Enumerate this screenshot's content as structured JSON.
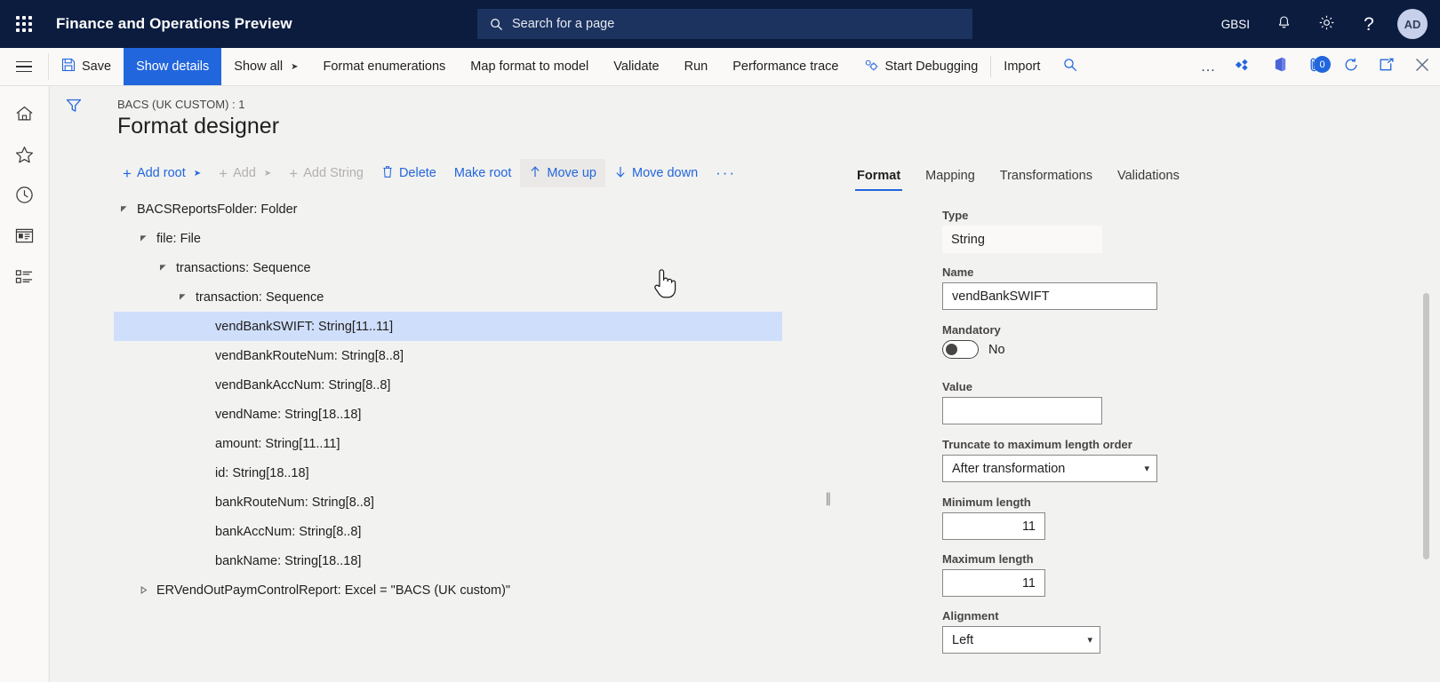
{
  "topnav": {
    "waffle_label": "app-launcher",
    "app_title": "Finance and Operations Preview",
    "search_placeholder": "Search for a page",
    "company": "GBSI",
    "notifications_icon": "bell-icon",
    "settings_icon": "gear-icon",
    "help_icon": "question-mark-icon",
    "avatar_initials": "AD"
  },
  "commandbar": {
    "menu_icon": "hamburger-icon",
    "save_label": "Save",
    "show_details_label": "Show details",
    "show_all_label": "Show all",
    "format_enumerations_label": "Format enumerations",
    "map_format_to_model_label": "Map format to model",
    "validate_label": "Validate",
    "run_label": "Run",
    "performance_trace_label": "Performance trace",
    "start_debugging_label": "Start Debugging",
    "import_label": "Import",
    "search_icon": "search-icon",
    "overflow_label": "…",
    "attachments_badge": "0"
  },
  "rail": {
    "items": [
      {
        "icon": "home-icon",
        "name": "home"
      },
      {
        "icon": "star-icon",
        "name": "favorites"
      },
      {
        "icon": "clock-icon",
        "name": "recent"
      },
      {
        "icon": "workspace-icon",
        "name": "workspaces"
      },
      {
        "icon": "modules-icon",
        "name": "modules"
      }
    ],
    "filter_icon": "filter-icon"
  },
  "page": {
    "breadcrumb": "BACS (UK CUSTOM) : 1",
    "title": "Format designer"
  },
  "designer_toolbar": {
    "add_root": "Add root",
    "add": "Add",
    "add_string": "Add String",
    "delete": "Delete",
    "make_root": "Make root",
    "move_up": "Move up",
    "move_down": "Move down",
    "more": "···"
  },
  "tree": {
    "nodes": [
      {
        "label": "BACSReportsFolder: Folder",
        "indent": 0,
        "twisty": "expanded",
        "selected": false
      },
      {
        "label": "file: File",
        "indent": 1,
        "twisty": "expanded",
        "selected": false
      },
      {
        "label": "transactions: Sequence",
        "indent": 2,
        "twisty": "expanded",
        "selected": false
      },
      {
        "label": "transaction: Sequence",
        "indent": 3,
        "twisty": "expanded",
        "selected": false
      },
      {
        "label": "vendBankSWIFT: String[11..11]",
        "indent": 4,
        "twisty": "none",
        "selected": true
      },
      {
        "label": "vendBankRouteNum: String[8..8]",
        "indent": 4,
        "twisty": "none",
        "selected": false
      },
      {
        "label": "vendBankAccNum: String[8..8]",
        "indent": 4,
        "twisty": "none",
        "selected": false
      },
      {
        "label": "vendName: String[18..18]",
        "indent": 4,
        "twisty": "none",
        "selected": false
      },
      {
        "label": "amount: String[11..11]",
        "indent": 4,
        "twisty": "none",
        "selected": false
      },
      {
        "label": "id: String[18..18]",
        "indent": 4,
        "twisty": "none",
        "selected": false
      },
      {
        "label": "bankRouteNum: String[8..8]",
        "indent": 4,
        "twisty": "none",
        "selected": false
      },
      {
        "label": "bankAccNum: String[8..8]",
        "indent": 4,
        "twisty": "none",
        "selected": false
      },
      {
        "label": "bankName: String[18..18]",
        "indent": 4,
        "twisty": "none",
        "selected": false
      },
      {
        "label": "ERVendOutPaymControlReport: Excel = \"BACS (UK custom)\"",
        "indent": 1,
        "twisty": "collapsed",
        "selected": false
      }
    ]
  },
  "rpanel": {
    "tabs": [
      {
        "label": "Format",
        "active": true
      },
      {
        "label": "Mapping",
        "active": false
      },
      {
        "label": "Transformations",
        "active": false
      },
      {
        "label": "Validations",
        "active": false
      }
    ],
    "type_label": "Type",
    "type_value": "String",
    "name_label": "Name",
    "name_value": "vendBankSWIFT",
    "mandatory_label": "Mandatory",
    "mandatory_value": "No",
    "value_label": "Value",
    "value_value": "",
    "truncate_label": "Truncate to maximum length order",
    "truncate_value": "After transformation",
    "min_length_label": "Minimum length",
    "min_length_value": "11",
    "max_length_label": "Maximum length",
    "max_length_value": "11",
    "alignment_label": "Alignment",
    "alignment_value": "Left"
  },
  "colors": {
    "nav_bg": "#0b1c3f",
    "accent": "#2266dd",
    "page_bg": "#f2f2f1",
    "selection": "#cfdffb"
  }
}
